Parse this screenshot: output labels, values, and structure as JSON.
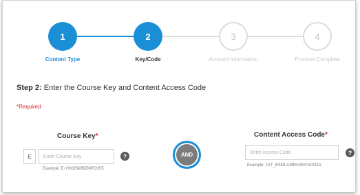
{
  "stepper": {
    "steps": [
      {
        "number": "1",
        "label": "Content Type",
        "state": "done"
      },
      {
        "number": "2",
        "label": "Key/Code",
        "state": "current"
      },
      {
        "number": "3",
        "label": "Account Information",
        "state": "todo"
      },
      {
        "number": "4",
        "label": "Process Complete",
        "state": "todo"
      }
    ]
  },
  "main": {
    "step_prefix": "Step 2:",
    "step_text": " Enter the Course Key and Content Access Code",
    "required_note": "*Required",
    "and_label": "AND"
  },
  "course_key": {
    "label": "Course Key",
    "required_mark": "*",
    "prefix": "E",
    "placeholder": "Enter Course Key",
    "example": "Example: E-Y0X8SWBZMPDV55"
  },
  "access_code": {
    "label": "Content Access Code",
    "required_mark": "*",
    "placeholder": "Enter Access Code",
    "example": "Example: 1ST_B388-4J9RV4SIYAPOZV"
  },
  "colors": {
    "accent": "#1a8fd6",
    "required": "#d6252a",
    "and_fill": "#7c7c7c"
  },
  "icons": [
    "help-icon"
  ]
}
